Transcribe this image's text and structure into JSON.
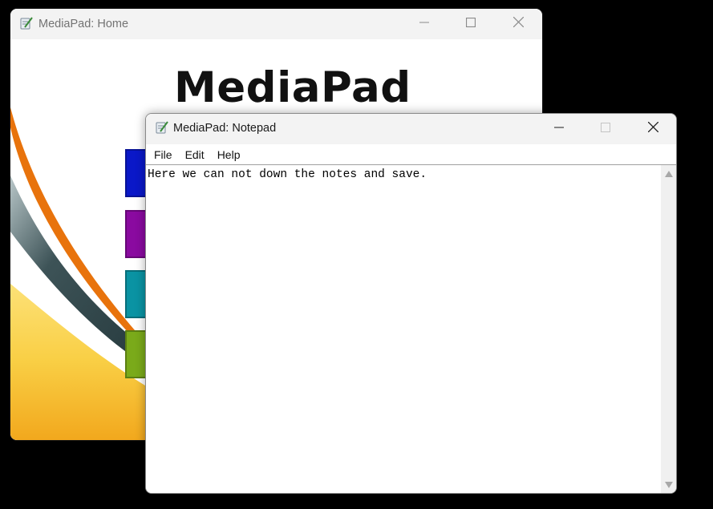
{
  "home_window": {
    "title": "MediaPad: Home",
    "logo_text": "MediaPad",
    "icons": {
      "app": "notepad-pen-icon",
      "minimize": "minimize-icon",
      "maximize": "maximize-icon",
      "close": "close-icon"
    },
    "tile_colors": [
      "#0a18c8",
      "#8a0aa0",
      "#0a93a3",
      "#7aaa1a"
    ]
  },
  "notepad_window": {
    "title": "MediaPad: Notepad",
    "menu": [
      "File",
      "Edit",
      "Help"
    ],
    "content": "Here we can not down the notes and save.",
    "icons": {
      "app": "notepad-pen-icon",
      "minimize": "minimize-icon",
      "maximize": "maximize-icon",
      "close": "close-icon",
      "scroll_up": "scroll-up-arrow-icon",
      "scroll_down": "scroll-down-arrow-icon"
    }
  },
  "colors": {
    "desktop": "#000000",
    "titlebar": "#f3f3f3",
    "swoosh_orange": "#e8730c",
    "swoosh_dark": "#2e3f44",
    "swoosh_yellow": "#f6c634"
  }
}
